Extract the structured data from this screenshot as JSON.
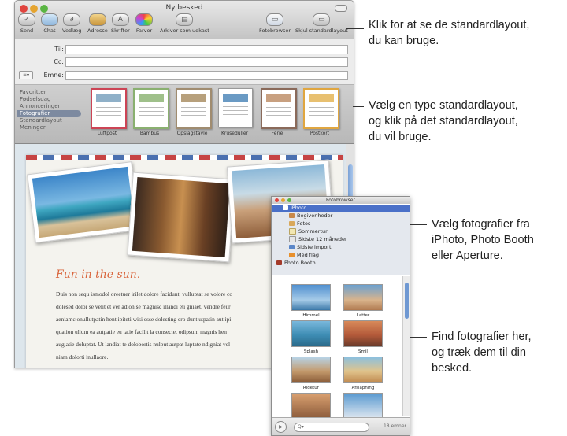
{
  "window": {
    "title": "Ny besked",
    "toolbar": [
      {
        "label": "Send",
        "icon": "send-icon"
      },
      {
        "label": "Chat",
        "icon": "chat-icon"
      },
      {
        "label": "Vedlæg",
        "icon": "paperclip-icon"
      },
      {
        "label": "Adresse",
        "icon": "address-book-icon"
      },
      {
        "label": "Skrifter",
        "icon": "fonts-icon"
      },
      {
        "label": "Farver",
        "icon": "colors-icon"
      },
      {
        "label": "Arkiver som udkast",
        "icon": "save-draft-icon"
      },
      {
        "label": "Fotobrowser",
        "icon": "photo-browser-icon"
      },
      {
        "label": "Skjul standardlayout",
        "icon": "stationery-icon"
      }
    ],
    "fields": {
      "to_label": "Til:",
      "cc_label": "Cc:",
      "subject_label": "Emne:",
      "to_value": "",
      "cc_value": "",
      "subject_value": ""
    },
    "stationery": {
      "categories": [
        "Favoritter",
        "Fødselsdag",
        "Annonceringer",
        "Fotografier",
        "Standardlayout",
        "Meninger"
      ],
      "selected_category": "Fotografier",
      "thumbnails": [
        "Luftpost",
        "Bambus",
        "Opslagstavle",
        "Kruseduller",
        "Ferie",
        "Postkort"
      ]
    },
    "message": {
      "heading": "Fun in the sun.",
      "lines": [
        "Duis non sequ ismodol oreetuer irilet dolore facidunt, vulluptat se volore co",
        "dolesed dolor se velit et ver adion se magnisc illandi eti gniaet, vendre feur",
        "aeniamc onullutpatin hent ipiteti wisi esse dolesting ero dunt utpatin aut ipi",
        "quation ullum ea autpatie eu tatie facilit la consectet odipsum magnis hen",
        "augiatie doluptat. Ut landiat te dolobortis nulput autpat luptate ndigniat vel",
        "niam dolorti inullaore."
      ]
    }
  },
  "photo_browser": {
    "title": "Fotobrowser",
    "sources": [
      {
        "label": "iPhoto",
        "level": 0,
        "selected": true
      },
      {
        "label": "Begivenheder",
        "level": 1
      },
      {
        "label": "Fotos",
        "level": 1
      },
      {
        "label": "Sommertur",
        "level": 1
      },
      {
        "label": "Sidste 12 måneder",
        "level": 1
      },
      {
        "label": "Sidste import",
        "level": 1
      },
      {
        "label": "Med flag",
        "level": 1
      },
      {
        "label": "Photo Booth",
        "level": 0
      }
    ],
    "photos": [
      "Himmel",
      "Latter",
      "Splash",
      "Smil",
      "Ridetur",
      "Afslapning"
    ],
    "search_placeholder": "Q▾",
    "count": "18 emner"
  },
  "callouts": [
    "Klik for at se de standardlayout,\ndu kan bruge.",
    "Vælg en type standardlayout,\nog klik på det standardlayout,\ndu vil bruge.",
    "Vælg fotografier fra\niPhoto, Photo Booth\neller Aperture.",
    "Find fotografier her,\nog træk dem til din\nbesked."
  ]
}
